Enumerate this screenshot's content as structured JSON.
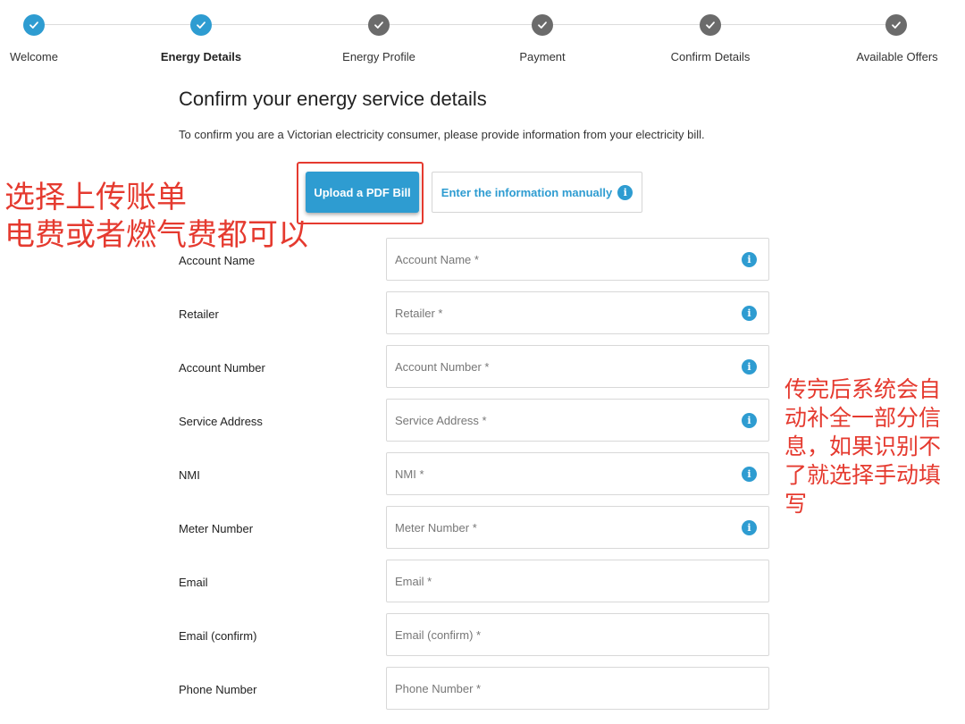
{
  "stepper": {
    "steps": [
      {
        "label": "Welcome",
        "state": "done"
      },
      {
        "label": "Energy Details",
        "state": "done",
        "active": true
      },
      {
        "label": "Energy Profile",
        "state": "pending"
      },
      {
        "label": "Payment",
        "state": "pending"
      },
      {
        "label": "Confirm Details",
        "state": "pending"
      },
      {
        "label": "Available Offers",
        "state": "pending"
      }
    ]
  },
  "page": {
    "title": "Confirm your energy service details",
    "description": "To confirm you are a Victorian electricity consumer, please provide information from your electricity bill."
  },
  "actions": {
    "upload_label": "Upload a PDF Bill",
    "manual_label": "Enter the information manually",
    "info_glyph": "i"
  },
  "annotations": {
    "left_line1": "选择上传账单",
    "left_line2": "电费或者燃气费都可以",
    "right": "传完后系统会自动补全一部分信息，如果识别不了就选择手动填写"
  },
  "form": {
    "fields": [
      {
        "label": "Account Name",
        "placeholder": "Account Name *",
        "info": true
      },
      {
        "label": "Retailer",
        "placeholder": "Retailer *",
        "info": true
      },
      {
        "label": "Account Number",
        "placeholder": "Account Number *",
        "info": true
      },
      {
        "label": "Service Address",
        "placeholder": "Service Address *",
        "info": true
      },
      {
        "label": "NMI",
        "placeholder": "NMI *",
        "info": true
      },
      {
        "label": "Meter Number",
        "placeholder": "Meter Number *",
        "info": true
      },
      {
        "label": "Email",
        "placeholder": "Email *",
        "info": false
      },
      {
        "label": "Email (confirm)",
        "placeholder": "Email (confirm) *",
        "info": false
      },
      {
        "label": "Phone Number",
        "placeholder": "Phone Number *",
        "info": false
      }
    ]
  },
  "colors": {
    "accent": "#2e9cd1",
    "pending": "#6b6b6b",
    "annotation": "#e53a2f"
  }
}
